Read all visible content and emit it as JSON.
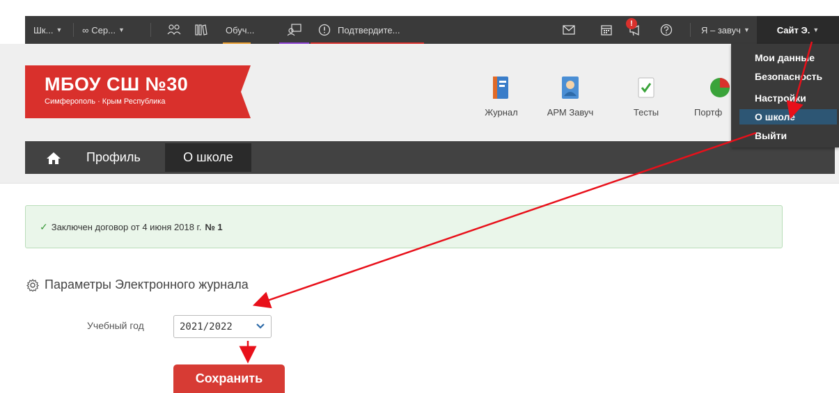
{
  "topbar": {
    "school_short": "Шк...",
    "service": "Сер...",
    "learning": "Обуч...",
    "confirm": "Подтвердите...",
    "notify_count": "!",
    "role": "Я – завуч",
    "site": "Сайт Э."
  },
  "logo": {
    "title": "МБОУ СШ №30",
    "subtitle": "Симферополь · Крым Республика",
    "color": "#d9302c"
  },
  "apps": [
    {
      "label": "Журнал",
      "icon": "journal-icon"
    },
    {
      "label": "АРМ Завуч",
      "icon": "arm-icon"
    },
    {
      "label": "Тесты",
      "icon": "tests-icon"
    },
    {
      "label": "Портф",
      "icon": "portfolio-icon"
    }
  ],
  "nav": {
    "profile": "Профиль",
    "school": "О школе"
  },
  "dropdown": {
    "items": [
      "Мои данные",
      "Безопасность",
      "Настройки",
      "О школе",
      "Выйти"
    ],
    "active_index": 3
  },
  "alert": {
    "text": "Заключен договор от 4 июня 2018 г.",
    "number_label": "№ 1"
  },
  "params": {
    "title": "Параметры Электронного журнала",
    "year_label": "Учебный год",
    "year_value": "2021/2022",
    "save": "Сохранить"
  },
  "colors": {
    "accent_red": "#d73b34",
    "active_blue": "#2d5674",
    "annotation_arrow": "#e8101a"
  }
}
